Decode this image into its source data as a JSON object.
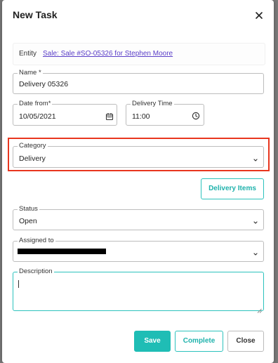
{
  "dialog": {
    "title": "New Task",
    "close_icon": "close-icon"
  },
  "entity": {
    "label": "Entity",
    "link_text": "Sale: Sale #SO-05326 for Stephen Moore"
  },
  "name_field": {
    "label": "Name *",
    "value": "Delivery 05326"
  },
  "date_field": {
    "label": "Date from*",
    "value": "10/05/2021",
    "icon": "calendar-icon"
  },
  "time_field": {
    "label": "Delivery Time",
    "value": "11:00",
    "icon": "clock-icon"
  },
  "category_field": {
    "label": "Category",
    "value": "Delivery",
    "icon": "chevron-down-icon"
  },
  "delivery_items_button": {
    "label": "Delivery Items"
  },
  "status_field": {
    "label": "Status",
    "value": "Open",
    "icon": "chevron-down-icon"
  },
  "assigned_field": {
    "label": "Assigned to",
    "icon": "chevron-down-icon"
  },
  "description_field": {
    "label": "Description",
    "value": ""
  },
  "footer": {
    "save_label": "Save",
    "complete_label": "Complete",
    "close_label": "Close"
  },
  "colors": {
    "accent": "#1fbdb5",
    "highlight": "#e8361f",
    "link": "#5a3ec8"
  }
}
